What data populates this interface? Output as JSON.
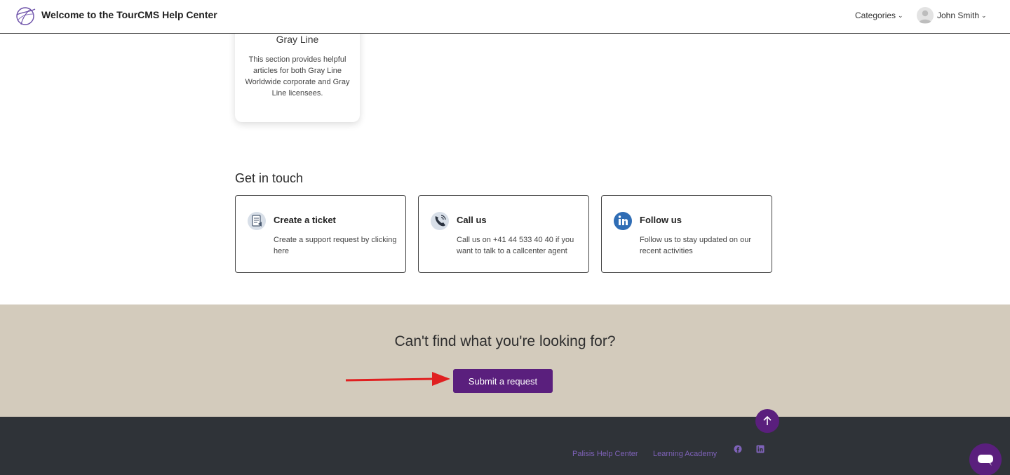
{
  "header": {
    "title": "Welcome to the TourCMS Help Center",
    "categories_label": "Categories",
    "user_name": "John Smith"
  },
  "category_card": {
    "title": "Gray Line",
    "description": "This section provides helpful articles for both Gray Line Worldwide corporate and Gray Line licensees."
  },
  "get_in_touch": {
    "heading": "Get in touch",
    "cards": [
      {
        "title": "Create a ticket",
        "description": "Create a support request by clicking here",
        "icon": "document-ticket-icon"
      },
      {
        "title": "Call us",
        "description": "Call us on +41 44 533 40 40 if you want to talk to a callcenter agent",
        "icon": "phone-icon"
      },
      {
        "title": "Follow us",
        "description": "Follow us to stay updated on our recent activities",
        "icon": "linkedin-icon"
      }
    ]
  },
  "cta": {
    "heading": "Can't find what you're looking for?",
    "button_label": "Submit a request"
  },
  "footer": {
    "links": [
      "Palisis Help Center",
      "Learning Academy"
    ],
    "social_icons": [
      "facebook-icon",
      "linkedin-icon"
    ]
  },
  "colors": {
    "brand_purple": "#5a1f7d",
    "cta_band": "#d3cbbc",
    "footer_bg": "#2f3338",
    "footer_link": "#7e62b8",
    "annotation_arrow": "#e02020"
  }
}
